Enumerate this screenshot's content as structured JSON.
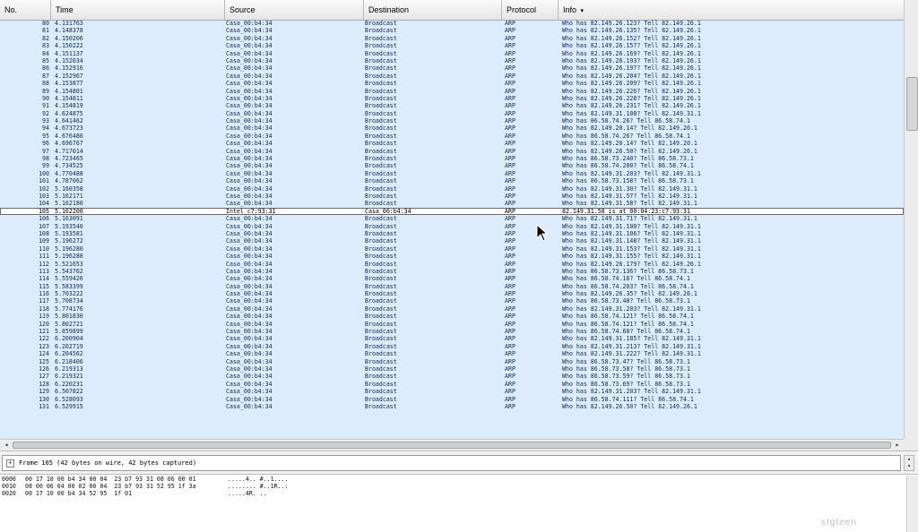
{
  "columns": {
    "no": "No.",
    "time": "Time",
    "source": "Source",
    "destination": "Destination",
    "protocol": "Protocol",
    "info": "Info"
  },
  "sort_indicator": "▾",
  "packets": [
    {
      "no": "80",
      "time": "4.131763",
      "src": "Casa_00:b4:34",
      "dst": "Broadcast",
      "proto": "ARP",
      "info": "Who has 82.149.26.123?  Tell 82.149.26.1"
    },
    {
      "no": "81",
      "time": "4.148378",
      "src": "Casa_00:b4:34",
      "dst": "Broadcast",
      "proto": "ARP",
      "info": "Who has 82.149.26.135?  Tell 82.149.26.1"
    },
    {
      "no": "82",
      "time": "4.150206",
      "src": "Casa_00:b4:34",
      "dst": "Broadcast",
      "proto": "ARP",
      "info": "Who has 82.149.26.152?  Tell 82.149.26.1"
    },
    {
      "no": "83",
      "time": "4.150222",
      "src": "Casa_00:b4:34",
      "dst": "Broadcast",
      "proto": "ARP",
      "info": "Who has 82.149.26.157?  Tell 82.149.26.1"
    },
    {
      "no": "84",
      "time": "4.151137",
      "src": "Casa_00:b4:34",
      "dst": "Broadcast",
      "proto": "ARP",
      "info": "Who has 82.149.26.169?  Tell 82.149.26.1"
    },
    {
      "no": "85",
      "time": "4.152034",
      "src": "Casa_00:b4:34",
      "dst": "Broadcast",
      "proto": "ARP",
      "info": "Who has 82.149.26.193?  Tell 82.149.26.1"
    },
    {
      "no": "86",
      "time": "4.152916",
      "src": "Casa_00:b4:34",
      "dst": "Broadcast",
      "proto": "ARP",
      "info": "Who has 82.149.26.197?  Tell 82.149.26.1"
    },
    {
      "no": "87",
      "time": "4.152967",
      "src": "Casa_00:b4:34",
      "dst": "Broadcast",
      "proto": "ARP",
      "info": "Who has 82.149.26.204?  Tell 82.149.26.1"
    },
    {
      "no": "88",
      "time": "4.153877",
      "src": "Casa_00:b4:34",
      "dst": "Broadcast",
      "proto": "ARP",
      "info": "Who has 82.149.26.209?  Tell 82.149.26.1"
    },
    {
      "no": "89",
      "time": "4.154801",
      "src": "Casa_00:b4:34",
      "dst": "Broadcast",
      "proto": "ARP",
      "info": "Who has 82.149.26.226?  Tell 82.149.26.1"
    },
    {
      "no": "90",
      "time": "4.154811",
      "src": "Casa_00:b4:34",
      "dst": "Broadcast",
      "proto": "ARP",
      "info": "Who has 82.149.26.228?  Tell 82.149.26.1"
    },
    {
      "no": "91",
      "time": "4.154819",
      "src": "Casa_00:b4:34",
      "dst": "Broadcast",
      "proto": "ARP",
      "info": "Who has 82.149.26.231?  Tell 82.149.26.1"
    },
    {
      "no": "92",
      "time": "4.624875",
      "src": "Casa_00:b4:34",
      "dst": "Broadcast",
      "proto": "ARP",
      "info": "Who has 82.149.31.108?  Tell 82.149.31.1"
    },
    {
      "no": "93",
      "time": "4.641462",
      "src": "Casa_00:b4:34",
      "dst": "Broadcast",
      "proto": "ARP",
      "info": "Who has 86.58.74.26?  Tell 86.58.74.1"
    },
    {
      "no": "94",
      "time": "4.673723",
      "src": "Casa_00:b4:34",
      "dst": "Broadcast",
      "proto": "ARP",
      "info": "Who has 82.149.20.14?  Tell 82.149.20.1"
    },
    {
      "no": "95",
      "time": "4.676480",
      "src": "Casa_00:b4:34",
      "dst": "Broadcast",
      "proto": "ARP",
      "info": "Who has 86.58.74.26?  Tell 86.58.74.1"
    },
    {
      "no": "96",
      "time": "4.696767",
      "src": "Casa_00:b4:34",
      "dst": "Broadcast",
      "proto": "ARP",
      "info": "Who has 82.149.20.14?  Tell 82.149.20.1"
    },
    {
      "no": "97",
      "time": "4.717014",
      "src": "Casa_00:b4:34",
      "dst": "Broadcast",
      "proto": "ARP",
      "info": "Who has 82.149.26.50?  Tell 82.149.26.1"
    },
    {
      "no": "98",
      "time": "4.723465",
      "src": "Casa_00:b4:34",
      "dst": "Broadcast",
      "proto": "ARP",
      "info": "Who has 86.58.73.240?  Tell 86.58.73.1"
    },
    {
      "no": "99",
      "time": "4.734525",
      "src": "Casa_00:b4:34",
      "dst": "Broadcast",
      "proto": "ARP",
      "info": "Who has 86.58.74.200?  Tell 86.58.74.1"
    },
    {
      "no": "100",
      "time": "4.770488",
      "src": "Casa_00:b4:34",
      "dst": "Broadcast",
      "proto": "ARP",
      "info": "Who has 82.149.31.203?  Tell 82.149.31.1"
    },
    {
      "no": "101",
      "time": "4.787062",
      "src": "Casa_00:b4:34",
      "dst": "Broadcast",
      "proto": "ARP",
      "info": "Who has 86.58.73.158?  Tell 86.58.73.1"
    },
    {
      "no": "102",
      "time": "5.160358",
      "src": "Casa_00:b4:34",
      "dst": "Broadcast",
      "proto": "ARP",
      "info": "Who has 82.149.31.30?  Tell 82.149.31.1"
    },
    {
      "no": "103",
      "time": "5.162171",
      "src": "Casa_00:b4:34",
      "dst": "Broadcast",
      "proto": "ARP",
      "info": "Who has 82.149.31.57?  Tell 82.149.31.1"
    },
    {
      "no": "104",
      "time": "5.162180",
      "src": "Casa_00:b4:34",
      "dst": "Broadcast",
      "proto": "ARP",
      "info": "Who has 82.149.31.58?  Tell 82.149.31.1"
    },
    {
      "no": "105",
      "time": "5.162200",
      "src": "Intel_c7:93:31",
      "dst": "Casa_00:b4:34",
      "proto": "ARP",
      "info": "82.149.31.58 is at 00:04:23:c7:93:31",
      "selected": true
    },
    {
      "no": "106",
      "time": "5.163091",
      "src": "Casa_00:b4:34",
      "dst": "Broadcast",
      "proto": "ARP",
      "info": "Who has 82.149.31.71?  Tell 82.149.31.1"
    },
    {
      "no": "107",
      "time": "5.193540",
      "src": "Casa_00:b4:34",
      "dst": "Broadcast",
      "proto": "ARP",
      "info": "Who has 82.149.31.100?  Tell 82.149.31.1"
    },
    {
      "no": "108",
      "time": "5.193581",
      "src": "Casa_00:b4:34",
      "dst": "Broadcast",
      "proto": "ARP",
      "info": "Who has 82.149.31.106?  Tell 82.149.31.1"
    },
    {
      "no": "109",
      "time": "5.196272",
      "src": "Casa_00:b4:34",
      "dst": "Broadcast",
      "proto": "ARP",
      "info": "Who has 82.149.31.148?  Tell 82.149.31.1"
    },
    {
      "no": "110",
      "time": "5.196280",
      "src": "Casa_00:b4:34",
      "dst": "Broadcast",
      "proto": "ARP",
      "info": "Who has 82.149.31.153?  Tell 82.149.31.1"
    },
    {
      "no": "111",
      "time": "5.196288",
      "src": "Casa_00:b4:34",
      "dst": "Broadcast",
      "proto": "ARP",
      "info": "Who has 82.149.31.155?  Tell 82.149.31.1"
    },
    {
      "no": "112",
      "time": "5.521653",
      "src": "Casa_00:b4:34",
      "dst": "Broadcast",
      "proto": "ARP",
      "info": "Who has 82.149.26.179?  Tell 82.149.26.1"
    },
    {
      "no": "113",
      "time": "5.543762",
      "src": "Casa_00:b4:34",
      "dst": "Broadcast",
      "proto": "ARP",
      "info": "Who has 86.58.73.136?  Tell 86.58.73.1"
    },
    {
      "no": "114",
      "time": "5.559426",
      "src": "Casa_00:b4:34",
      "dst": "Broadcast",
      "proto": "ARP",
      "info": "Who has 86.58.74.16?  Tell 86.58.74.1"
    },
    {
      "no": "115",
      "time": "5.583399",
      "src": "Casa_00:b4:34",
      "dst": "Broadcast",
      "proto": "ARP",
      "info": "Who has 86.58.74.203?  Tell 86.58.74.1"
    },
    {
      "no": "116",
      "time": "5.703222",
      "src": "Casa_00:b4:34",
      "dst": "Broadcast",
      "proto": "ARP",
      "info": "Who has 82.149.26.35?  Tell 82.149.26.1"
    },
    {
      "no": "117",
      "time": "5.708734",
      "src": "Casa_00:b4:34",
      "dst": "Broadcast",
      "proto": "ARP",
      "info": "Who has 86.58.73.48?  Tell 86.58.73.1"
    },
    {
      "no": "118",
      "time": "5.774176",
      "src": "Casa_00:b4:34",
      "dst": "Broadcast",
      "proto": "ARP",
      "info": "Who has 82.149.31.203?  Tell 82.149.31.1"
    },
    {
      "no": "119",
      "time": "5.801830",
      "src": "Casa_00:b4:34",
      "dst": "Broadcast",
      "proto": "ARP",
      "info": "Who has 86.58.74.121?  Tell 86.58.74.1"
    },
    {
      "no": "120",
      "time": "5.802721",
      "src": "Casa_00:b4:34",
      "dst": "Broadcast",
      "proto": "ARP",
      "info": "Who has 86.58.74.121?  Tell 86.58.74.1"
    },
    {
      "no": "121",
      "time": "5.859899",
      "src": "Casa_00:b4:34",
      "dst": "Broadcast",
      "proto": "ARP",
      "info": "Who has 86.58.74.68?  Tell 86.58.74.1"
    },
    {
      "no": "122",
      "time": "6.200904",
      "src": "Casa_00:b4:34",
      "dst": "Broadcast",
      "proto": "ARP",
      "info": "Who has 82.149.31.185?  Tell 82.149.31.1"
    },
    {
      "no": "123",
      "time": "6.202719",
      "src": "Casa_00:b4:34",
      "dst": "Broadcast",
      "proto": "ARP",
      "info": "Who has 82.149.31.213?  Tell 82.149.31.1"
    },
    {
      "no": "124",
      "time": "6.204562",
      "src": "Casa_00:b4:34",
      "dst": "Broadcast",
      "proto": "ARP",
      "info": "Who has 82.149.31.222?  Tell 82.149.31.1"
    },
    {
      "no": "125",
      "time": "6.218406",
      "src": "Casa_00:b4:34",
      "dst": "Broadcast",
      "proto": "ARP",
      "info": "Who has 86.58.73.47?  Tell 86.58.73.1"
    },
    {
      "no": "126",
      "time": "6.219313",
      "src": "Casa_00:b4:34",
      "dst": "Broadcast",
      "proto": "ARP",
      "info": "Who has 86.58.73.58?  Tell 86.58.73.1"
    },
    {
      "no": "127",
      "time": "6.219321",
      "src": "Casa_00:b4:34",
      "dst": "Broadcast",
      "proto": "ARP",
      "info": "Who has 86.58.73.59?  Tell 86.58.73.1"
    },
    {
      "no": "128",
      "time": "6.220231",
      "src": "Casa_00:b4:34",
      "dst": "Broadcast",
      "proto": "ARP",
      "info": "Who has 86.58.73.69?  Tell 86.58.73.1"
    },
    {
      "no": "129",
      "time": "6.507822",
      "src": "Casa_00:b4:34",
      "dst": "Broadcast",
      "proto": "ARP",
      "info": "Who has 82.149.31.203?  Tell 82.149.31.1"
    },
    {
      "no": "130",
      "time": "6.528093",
      "src": "Casa_00:b4:34",
      "dst": "Broadcast",
      "proto": "ARP",
      "info": "Who has 86.58.74.111?  Tell 86.58.74.1"
    },
    {
      "no": "131",
      "time": "6.529915",
      "src": "Casa_00:b4:34",
      "dst": "Broadcast",
      "proto": "ARP",
      "info": "Who has 82.149.26.50?  Tell 82.149.26.1"
    }
  ],
  "details": {
    "expander": "+",
    "frame_summary": "Frame 105 (42 bytes on wire, 42 bytes captured)"
  },
  "bytes": [
    {
      "offset": "0000",
      "hex": "00 17 10 00 b4 34 00 04  23 b7 93 31 08 06 00 01",
      "ascii": ".....4.. #..1...."
    },
    {
      "offset": "0010",
      "hex": "08 00 06 04 00 02 00 04  23 b7 93 31 52 95 1f 3a",
      "ascii": "........ #..1R..:"
    },
    {
      "offset": "0020",
      "hex": "00 17 10 00 b4 34 52 95  1f 01",
      "ascii": ".....4R. .."
    }
  ],
  "scroll": {
    "left_arrow": "◂",
    "right_arrow": "▸",
    "up_arrow": "▴",
    "down_arrow": "▾"
  },
  "watermark": "stgteen",
  "colors": {
    "row_bg": "#dcecfd",
    "row_text": "#0c2a52",
    "selected_bg": "#ffffff"
  }
}
